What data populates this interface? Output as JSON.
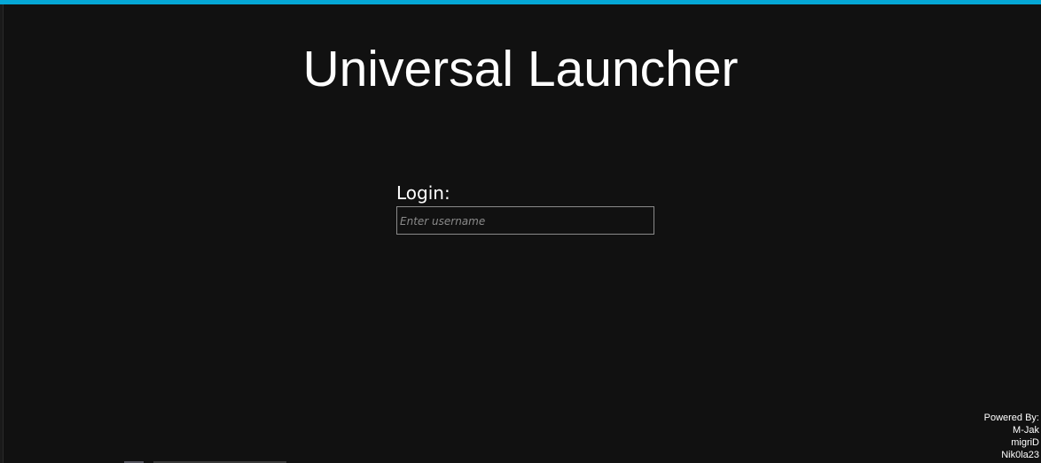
{
  "window": {
    "accent_color": "#05a7d6",
    "background_color": "#111111"
  },
  "header": {
    "title": "Universal Launcher"
  },
  "login": {
    "label": "Login:",
    "username_placeholder": "Enter username",
    "username_value": ""
  },
  "credits": {
    "heading": "Powered By:",
    "authors": [
      "M-Jak",
      "migriD",
      "Nik0la23"
    ]
  }
}
